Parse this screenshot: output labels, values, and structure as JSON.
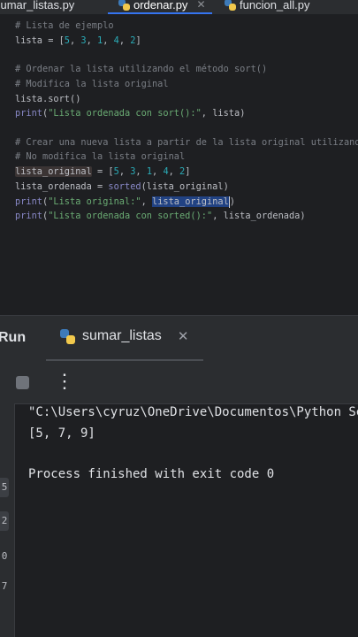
{
  "tabs": [
    {
      "label": "sumar_listas.py",
      "active": false
    },
    {
      "label": "ordenar.py",
      "active": true
    },
    {
      "label": "funcion_all.py",
      "active": false
    }
  ],
  "editor": {
    "lines": {
      "l1": "# Lista de ejemplo",
      "l2_a": "lista = [",
      "l2_n1": "5",
      "l2_n2": "3",
      "l2_n3": "1",
      "l2_n4": "4",
      "l2_n5": "2",
      "l4": "# Ordenar la lista utilizando el método sort()",
      "l5": "# Modifica la lista original",
      "l6": "lista.sort()",
      "l7_fn": "print",
      "l7_str": "\"Lista ordenada con sort():\"",
      "l7_rest": ", lista)",
      "l9": "# Crear una nueva lista a partir de la lista original utilizando",
      "l10": "# No modifica la lista original",
      "l11_var": "lista_original",
      "l11_rest": " = [",
      "l11_n1": "5",
      "l11_n2": "3",
      "l11_n3": "1",
      "l11_n4": "4",
      "l11_n5": "2",
      "l12_a": "lista_ordenada = ",
      "l12_fn": "sorted",
      "l12_b": "(lista_original)",
      "l13_fn": "print",
      "l13_str": "\"Lista original:\"",
      "l13_sep": ", ",
      "l13_sel": "lista_original",
      "l14_fn": "print",
      "l14_str": "\"Lista ordenada con sorted():\"",
      "l14_rest": ", lista_ordenada)"
    }
  },
  "run_panel": {
    "title": "Run",
    "tab_label": "sumar_listas",
    "output": [
      "\"C:\\Users\\cyruz\\OneDrive\\Documentos\\Python Se",
      "[5, 7, 9]",
      "",
      "Process finished with exit code 0"
    ],
    "gutter_glyphs": [
      "5",
      "2",
      "0",
      "7"
    ]
  }
}
